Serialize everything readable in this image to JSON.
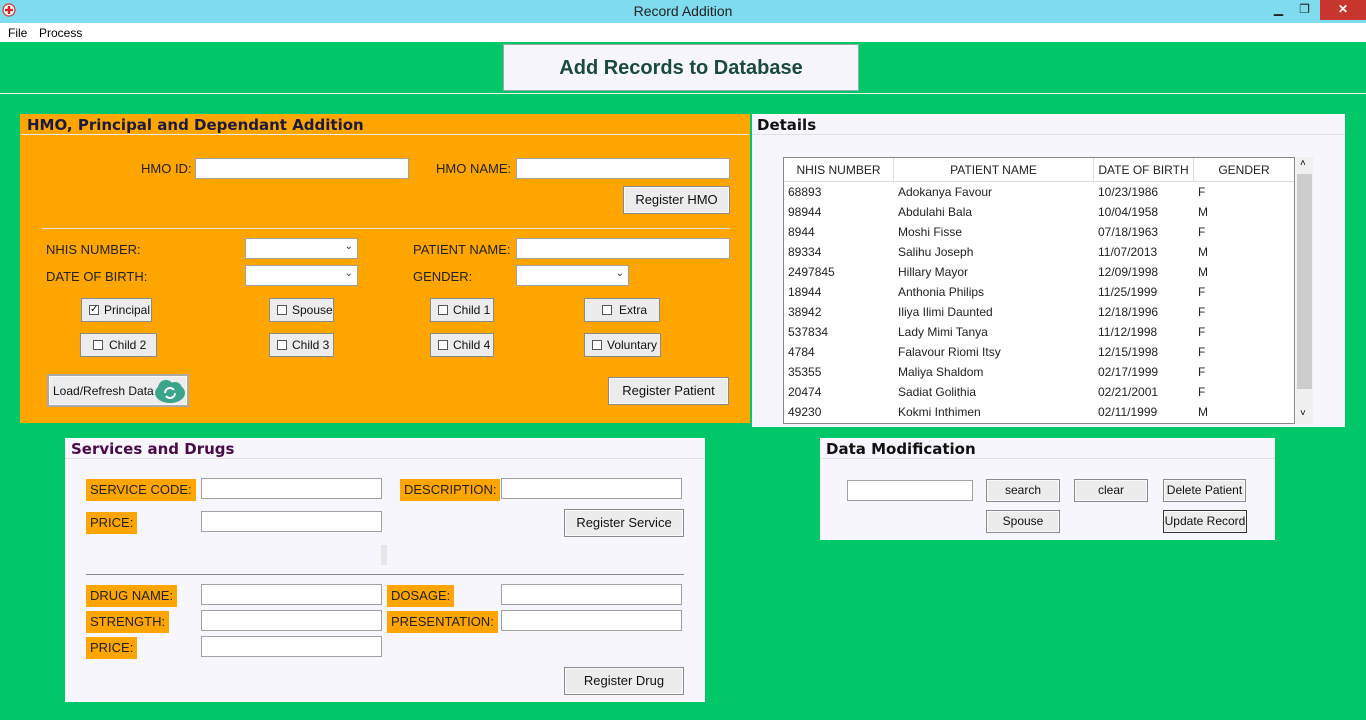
{
  "window": {
    "title": "Record Addition",
    "minimize": "▁",
    "maximize": "❐",
    "close": "✕"
  },
  "menu": [
    "File",
    "Process"
  ],
  "header": "Add Records to Database",
  "hmo_panel": {
    "title": "HMO, Principal and Dependant Addition",
    "hmo_id_label": "HMO ID:",
    "hmo_name_label": "HMO NAME:",
    "register_hmo": "Register HMO",
    "nhis_label": "NHIS NUMBER:",
    "patient_name_label": "PATIENT NAME:",
    "dob_label": "DATE OF BIRTH:",
    "gender_label": "GENDER:",
    "checkboxes": [
      {
        "label": "Principal",
        "checked": true
      },
      {
        "label": "Spouse",
        "checked": false
      },
      {
        "label": "Child 1",
        "checked": false
      },
      {
        "label": "Extra",
        "checked": false
      },
      {
        "label": "Child 2",
        "checked": false
      },
      {
        "label": "Child 3",
        "checked": false
      },
      {
        "label": "Child 4",
        "checked": false
      },
      {
        "label": "Voluntary",
        "checked": false
      }
    ],
    "load_refresh": "Load/Refresh Data",
    "register_patient": "Register Patient"
  },
  "details": {
    "title": "Details",
    "columns": [
      "NHIS NUMBER",
      "PATIENT NAME",
      "DATE OF BIRTH",
      "GENDER"
    ],
    "rows": [
      [
        "68893",
        "Adokanya Favour",
        "10/23/1986",
        "F"
      ],
      [
        "98944",
        "Abdulahi Bala",
        "10/04/1958",
        "M"
      ],
      [
        "8944",
        "Moshi Fisse",
        "07/18/1963",
        "F"
      ],
      [
        "89334",
        "Salihu Joseph",
        "11/07/2013",
        "M"
      ],
      [
        "2497845",
        "Hillary Mayor",
        "12/09/1998",
        "M"
      ],
      [
        "18944",
        "Anthonia Philips",
        "11/25/1999",
        "F"
      ],
      [
        "38942",
        "Iliya Ilimi Daunted",
        "12/18/1996",
        "F"
      ],
      [
        "537834",
        "Lady Mimi Tanya",
        "11/12/1998",
        "F"
      ],
      [
        "4784",
        "Falavour Riomi Itsy",
        "12/15/1998",
        "F"
      ],
      [
        "35355",
        "Maliya Shaldom",
        "02/17/1999",
        "F"
      ],
      [
        "20474",
        "Sadiat Golithia",
        "02/21/2001",
        "F"
      ],
      [
        "49230",
        "Kokmi Inthimen",
        "02/11/1999",
        "M"
      ]
    ]
  },
  "services": {
    "title": "Services and Drugs",
    "service_code": "SERVICE CODE:",
    "description": "DESCRIPTION:",
    "price": "PRICE:",
    "register_service": "Register Service",
    "drug_name": "DRUG NAME:",
    "dosage": "DOSAGE:",
    "strength": "STRENGTH:",
    "presentation": "PRESENTATION:",
    "drug_price": "PRICE:",
    "register_drug": "Register Drug"
  },
  "modification": {
    "title": "Data Modification",
    "search": "search",
    "clear": "clear",
    "delete_patient": "Delete Patient",
    "spouse": "Spouse",
    "update_record": "Update Record"
  }
}
